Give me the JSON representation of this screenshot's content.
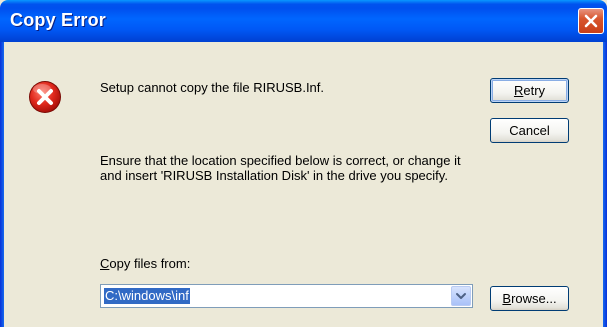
{
  "window": {
    "title": "Copy Error"
  },
  "message": {
    "line1": "Setup cannot copy the file RIRUSB.Inf.",
    "line2": "Ensure that the location specified below is correct, or change it and insert 'RIRUSB Installation Disk' in the drive you specify."
  },
  "copy_from": {
    "label_first": "C",
    "label_rest": "opy files from:",
    "value": "C:\\windows\\inf"
  },
  "buttons": {
    "retry_first": "R",
    "retry_rest": "etry",
    "cancel": "Cancel",
    "browse_first": "B",
    "browse_rest": "rowse..."
  },
  "icons": {
    "close": "close-icon",
    "error": "error-icon",
    "dropdown": "chevron-down-icon"
  },
  "colors": {
    "titlebar": "#0058f5",
    "dialog_bg": "#ece9d8",
    "error_red": "#d9261c",
    "selection": "#316ac5"
  }
}
